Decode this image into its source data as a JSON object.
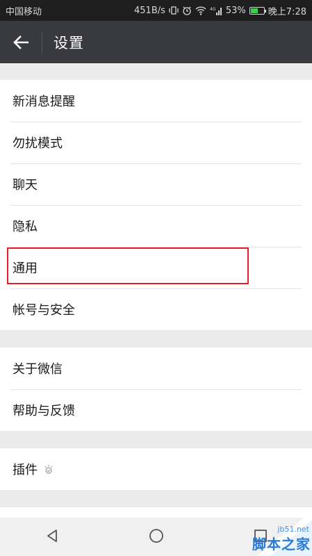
{
  "status": {
    "carrier": "中国移动",
    "speed": "451B/s",
    "network": "4G",
    "battery": "53%",
    "battery_level": 0.53,
    "time": "晚上7:28"
  },
  "header": {
    "title": "设置"
  },
  "groups": [
    {
      "items": [
        "新消息提醒",
        "勿扰模式",
        "聊天",
        "隐私",
        "通用",
        "帐号与安全"
      ]
    },
    {
      "items": [
        "关于微信",
        "帮助与反馈"
      ]
    },
    {
      "items": [
        "插件"
      ]
    }
  ],
  "colors": {
    "header_bg": "#393a3f",
    "highlight": "#e41f2b",
    "battery_fill": "#3ad04a"
  },
  "watermark": {
    "domain": "jb51.net",
    "name": "脚本之家"
  }
}
